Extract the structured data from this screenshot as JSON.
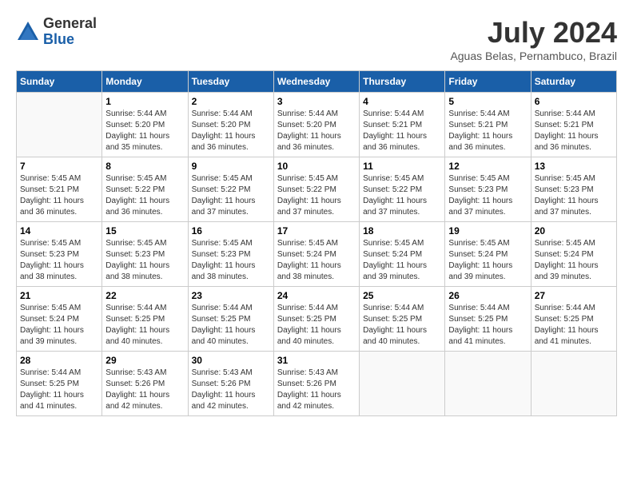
{
  "header": {
    "logo_general": "General",
    "logo_blue": "Blue",
    "month_title": "July 2024",
    "location": "Aguas Belas, Pernambuco, Brazil"
  },
  "calendar": {
    "days_of_week": [
      "Sunday",
      "Monday",
      "Tuesday",
      "Wednesday",
      "Thursday",
      "Friday",
      "Saturday"
    ],
    "weeks": [
      [
        {
          "day": "",
          "info": ""
        },
        {
          "day": "1",
          "info": "Sunrise: 5:44 AM\nSunset: 5:20 PM\nDaylight: 11 hours\nand 35 minutes."
        },
        {
          "day": "2",
          "info": "Sunrise: 5:44 AM\nSunset: 5:20 PM\nDaylight: 11 hours\nand 36 minutes."
        },
        {
          "day": "3",
          "info": "Sunrise: 5:44 AM\nSunset: 5:20 PM\nDaylight: 11 hours\nand 36 minutes."
        },
        {
          "day": "4",
          "info": "Sunrise: 5:44 AM\nSunset: 5:21 PM\nDaylight: 11 hours\nand 36 minutes."
        },
        {
          "day": "5",
          "info": "Sunrise: 5:44 AM\nSunset: 5:21 PM\nDaylight: 11 hours\nand 36 minutes."
        },
        {
          "day": "6",
          "info": "Sunrise: 5:44 AM\nSunset: 5:21 PM\nDaylight: 11 hours\nand 36 minutes."
        }
      ],
      [
        {
          "day": "7",
          "info": "Sunrise: 5:45 AM\nSunset: 5:21 PM\nDaylight: 11 hours\nand 36 minutes."
        },
        {
          "day": "8",
          "info": "Sunrise: 5:45 AM\nSunset: 5:22 PM\nDaylight: 11 hours\nand 36 minutes."
        },
        {
          "day": "9",
          "info": "Sunrise: 5:45 AM\nSunset: 5:22 PM\nDaylight: 11 hours\nand 37 minutes."
        },
        {
          "day": "10",
          "info": "Sunrise: 5:45 AM\nSunset: 5:22 PM\nDaylight: 11 hours\nand 37 minutes."
        },
        {
          "day": "11",
          "info": "Sunrise: 5:45 AM\nSunset: 5:22 PM\nDaylight: 11 hours\nand 37 minutes."
        },
        {
          "day": "12",
          "info": "Sunrise: 5:45 AM\nSunset: 5:23 PM\nDaylight: 11 hours\nand 37 minutes."
        },
        {
          "day": "13",
          "info": "Sunrise: 5:45 AM\nSunset: 5:23 PM\nDaylight: 11 hours\nand 37 minutes."
        }
      ],
      [
        {
          "day": "14",
          "info": "Sunrise: 5:45 AM\nSunset: 5:23 PM\nDaylight: 11 hours\nand 38 minutes."
        },
        {
          "day": "15",
          "info": "Sunrise: 5:45 AM\nSunset: 5:23 PM\nDaylight: 11 hours\nand 38 minutes."
        },
        {
          "day": "16",
          "info": "Sunrise: 5:45 AM\nSunset: 5:23 PM\nDaylight: 11 hours\nand 38 minutes."
        },
        {
          "day": "17",
          "info": "Sunrise: 5:45 AM\nSunset: 5:24 PM\nDaylight: 11 hours\nand 38 minutes."
        },
        {
          "day": "18",
          "info": "Sunrise: 5:45 AM\nSunset: 5:24 PM\nDaylight: 11 hours\nand 39 minutes."
        },
        {
          "day": "19",
          "info": "Sunrise: 5:45 AM\nSunset: 5:24 PM\nDaylight: 11 hours\nand 39 minutes."
        },
        {
          "day": "20",
          "info": "Sunrise: 5:45 AM\nSunset: 5:24 PM\nDaylight: 11 hours\nand 39 minutes."
        }
      ],
      [
        {
          "day": "21",
          "info": "Sunrise: 5:45 AM\nSunset: 5:24 PM\nDaylight: 11 hours\nand 39 minutes."
        },
        {
          "day": "22",
          "info": "Sunrise: 5:44 AM\nSunset: 5:25 PM\nDaylight: 11 hours\nand 40 minutes."
        },
        {
          "day": "23",
          "info": "Sunrise: 5:44 AM\nSunset: 5:25 PM\nDaylight: 11 hours\nand 40 minutes."
        },
        {
          "day": "24",
          "info": "Sunrise: 5:44 AM\nSunset: 5:25 PM\nDaylight: 11 hours\nand 40 minutes."
        },
        {
          "day": "25",
          "info": "Sunrise: 5:44 AM\nSunset: 5:25 PM\nDaylight: 11 hours\nand 40 minutes."
        },
        {
          "day": "26",
          "info": "Sunrise: 5:44 AM\nSunset: 5:25 PM\nDaylight: 11 hours\nand 41 minutes."
        },
        {
          "day": "27",
          "info": "Sunrise: 5:44 AM\nSunset: 5:25 PM\nDaylight: 11 hours\nand 41 minutes."
        }
      ],
      [
        {
          "day": "28",
          "info": "Sunrise: 5:44 AM\nSunset: 5:25 PM\nDaylight: 11 hours\nand 41 minutes."
        },
        {
          "day": "29",
          "info": "Sunrise: 5:43 AM\nSunset: 5:26 PM\nDaylight: 11 hours\nand 42 minutes."
        },
        {
          "day": "30",
          "info": "Sunrise: 5:43 AM\nSunset: 5:26 PM\nDaylight: 11 hours\nand 42 minutes."
        },
        {
          "day": "31",
          "info": "Sunrise: 5:43 AM\nSunset: 5:26 PM\nDaylight: 11 hours\nand 42 minutes."
        },
        {
          "day": "",
          "info": ""
        },
        {
          "day": "",
          "info": ""
        },
        {
          "day": "",
          "info": ""
        }
      ]
    ]
  }
}
